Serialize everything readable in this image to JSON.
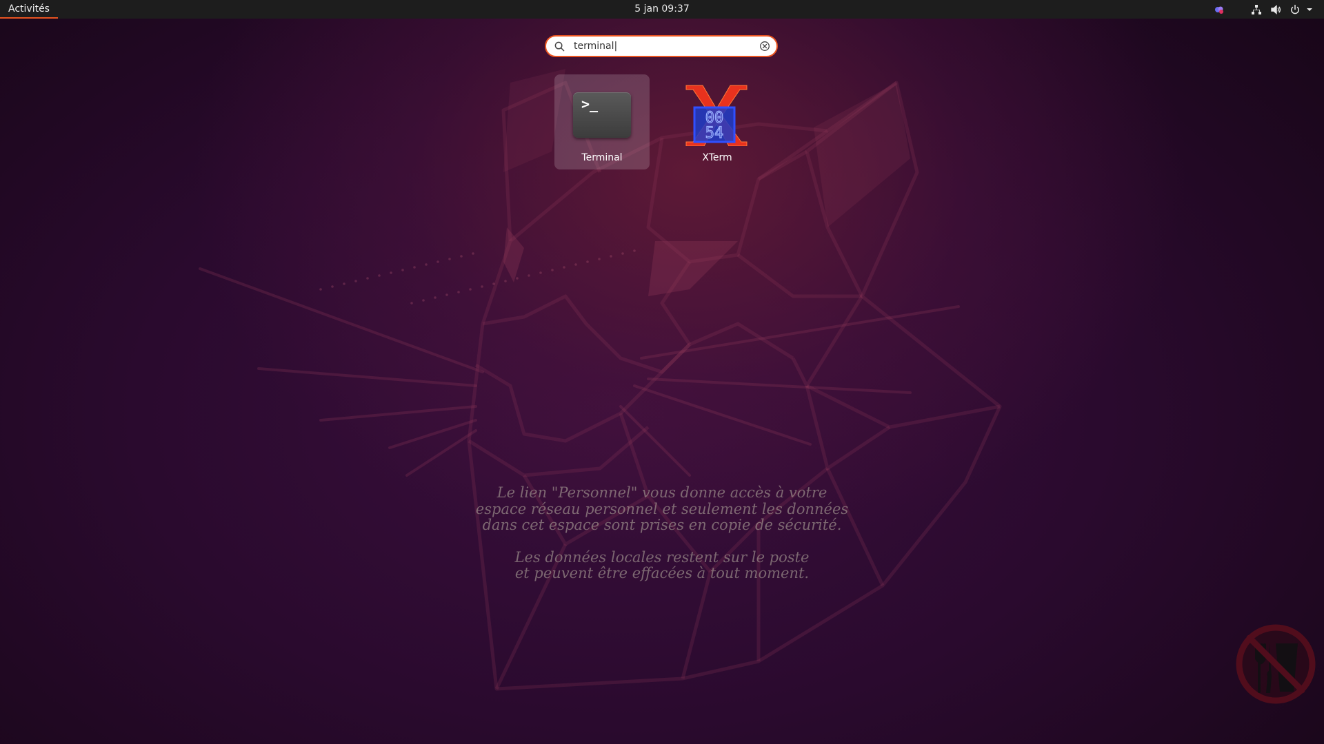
{
  "top_bar": {
    "activities_label": "Activités",
    "clock": "5 jan  09:37",
    "tray_icons": [
      "app-indicator-icon",
      "network-icon",
      "volume-icon",
      "power-icon",
      "chevron-down-icon"
    ]
  },
  "search": {
    "value": "terminal|",
    "placeholder": ""
  },
  "results": [
    {
      "label": "Terminal",
      "icon": "terminal-app-icon",
      "selected": true
    },
    {
      "label": "XTerm",
      "icon": "xterm-app-icon",
      "selected": false
    }
  ],
  "xterm_icon_digits": [
    "00",
    "54"
  ],
  "terminal_icon_glyph": ">_",
  "wallpaper_notice": {
    "paragraph1": [
      "Le lien \"Personnel\" vous donne accès à votre",
      "espace réseau personnel et seulement les données",
      "dans cet espace sont prises en copie de sécurité."
    ],
    "paragraph2": [
      "Les données locales restent sur le poste",
      "et peuvent être effacées à tout moment."
    ]
  },
  "colors": {
    "accent": "#e95420",
    "top_bar": "#1d1d1d",
    "background": "#2a0a2e"
  }
}
